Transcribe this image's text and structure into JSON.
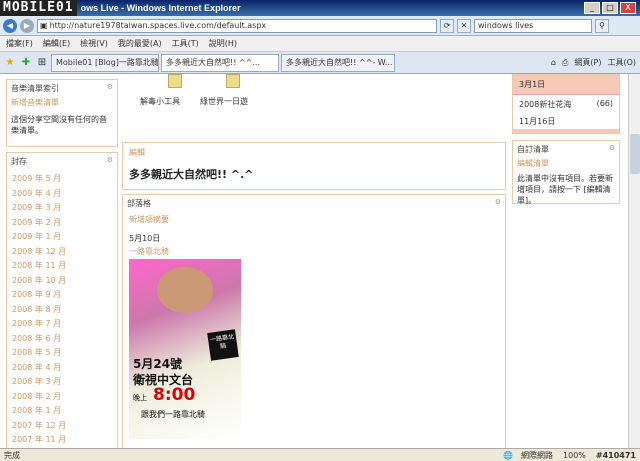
{
  "window": {
    "watermark": "MOBILE01",
    "title": "ows Live - Windows Internet Explorer",
    "minimize": "_",
    "maximize": "□",
    "close": "X"
  },
  "address": {
    "url": "http://nature1978taiwan.spaces.live.com/default.aspx",
    "search": "windows lives"
  },
  "menu": [
    "檔案(F)",
    "編輯(E)",
    "檢視(V)",
    "我的最愛(A)",
    "工具(T)",
    "說明(H)"
  ],
  "tabs": [
    "Mobile01 [Blog]一路靠北騎",
    "多多親近大自然吧!! ^^...",
    "多多親近大自然吧!! ^^- W..."
  ],
  "toolbar": {
    "page": "網頁(P)",
    "tools": "工具(O)"
  },
  "left": {
    "music": {
      "title": "音樂清單索引",
      "link": "新增音樂清單",
      "text": "這個分享空間沒有任何的音樂清單。"
    },
    "archive": {
      "title": "封存",
      "items": [
        "2009 年 5 月",
        "2009 年 4 月",
        "2009 年 3 月",
        "2009 年 2 月",
        "2009 年 1 月",
        "2008 年 12 月",
        "2008 年 11 月",
        "2008 年 10 月",
        "2008 年 9 月",
        "2008 年 8 月",
        "2008 年 7 月",
        "2008 年 6 月",
        "2008 年 5 月",
        "2008 年 4 月",
        "2008 年 3 月",
        "2008 年 2 月",
        "2008 年 1 月",
        "2007 年 12 月",
        "2007 年 11 月"
      ]
    }
  },
  "center": {
    "icons": [
      "解毒小工具",
      "綠世界一日遊"
    ],
    "edit": {
      "label": "編輯",
      "title": "多多親近大自然吧!! ^.^"
    },
    "blog": {
      "title": "部落格",
      "link": "新增項摘要",
      "date": "5月10日",
      "post_title": "一路靠北騎"
    },
    "poster": {
      "date": "5月24號",
      "channel": "衛視中文台",
      "evening": "晚上",
      "time": "8:00",
      "tagline": "跟我們一路靠北騎",
      "badge": "一路靠北騎"
    }
  },
  "right": {
    "top": {
      "item1": "3月1日",
      "item2": "2008新社花海",
      "count": "(66)",
      "item3": "11月16日"
    },
    "custom": {
      "title": "自訂清單",
      "link": "編輯清單",
      "text": "此清單中沒有項目。若要新增項目，請按一下 [編輯清單]。"
    }
  },
  "status": {
    "left": "完成",
    "zone": "網際網路",
    "zoom": "100%",
    "id": "#410471"
  }
}
